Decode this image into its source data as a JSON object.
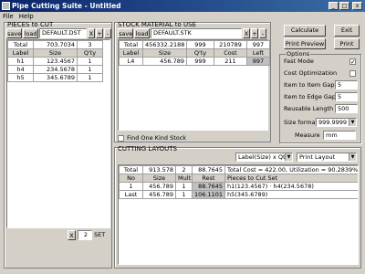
{
  "window": {
    "title": "Pipe Cutting Suite - Untitled",
    "min": "_",
    "max": "□",
    "close": "x"
  },
  "menu": {
    "file": "File",
    "help": "Help"
  },
  "pieces": {
    "title": "PIECES to CUT",
    "save": "save",
    "load": "load",
    "file": "DEFAULT.DST",
    "x": "X",
    "add": "+",
    "remove": "-",
    "total": {
      "label": "Total",
      "size": "703.7034",
      "qty": "3"
    },
    "headers": [
      "Label",
      "Size",
      "Q'ty"
    ],
    "rows": [
      [
        "h1",
        "123.4567",
        "1"
      ],
      [
        "h4",
        "234.5678",
        "1"
      ],
      [
        "h5",
        "345.6789",
        "1"
      ]
    ],
    "pager": {
      "x": "X",
      "value": "2",
      "set": "SET"
    }
  },
  "stock": {
    "title": "STOCK MATERIAL to USE",
    "save": "save",
    "load": "load",
    "file": "DEFAULT.STK",
    "x": "X",
    "add": "+",
    "remove": "-",
    "total": {
      "label": "Total",
      "size": "456332.2188",
      "qty": "999",
      "cost": "210789",
      "left": "997"
    },
    "headers": [
      "Label",
      "Size",
      "Q'ty",
      "Cost",
      "Left"
    ],
    "rows": [
      [
        "L4",
        "456.789",
        "999",
        "211",
        "997"
      ]
    ],
    "find_one_kind": "Find One Kind Stock"
  },
  "actions": {
    "calculate": "Calculate",
    "exit": "Exit",
    "print_preview": "Print Preview",
    "print": "Print"
  },
  "options": {
    "title": "Options",
    "fast_mode": "Fast Mode",
    "fast_mode_checked": "✓",
    "cost_opt": "Cost Optimization",
    "item_to_item": "Item to Item Gap",
    "item_to_item_value": "5",
    "item_to_edge": "Item to Edge Gap",
    "item_to_edge_value": "5",
    "reusable": "Reusable Length",
    "reusable_value": "500",
    "size_format": "Size format",
    "size_format_value": "999.9999",
    "measure": "Measure",
    "measure_value": "mm"
  },
  "layouts": {
    "title": "CUTTING LAYOUTS",
    "label_mode": "Label(Size) x Qty",
    "print_layout": "Print Layout",
    "total": {
      "label": "Total",
      "size": "913.578",
      "mult": "2",
      "rest": "88.7645",
      "summary": "Total Cost = 422.00, Utilization = 90.2839%"
    },
    "headers": [
      "No",
      "Size",
      "Mult",
      "Rest",
      "Pieces to Cut Set"
    ],
    "rows": [
      [
        "1",
        "456.789",
        "1",
        "88.7645",
        "h1(123.4567) · h4(234.5678)"
      ],
      [
        "Last",
        "456.789",
        "1",
        "106.1101",
        "h5(345.6789)"
      ]
    ]
  }
}
